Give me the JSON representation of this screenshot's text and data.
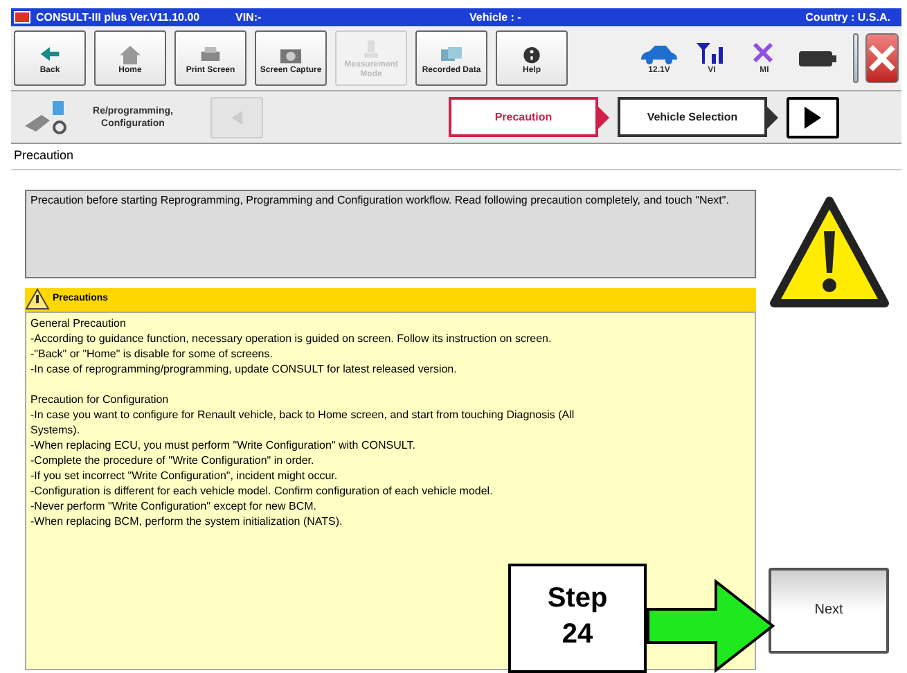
{
  "title_bar": {
    "app": "CONSULT-III plus  Ver.V11.10.00",
    "vin": "VIN:-",
    "vehicle": "Vehicle : -",
    "country": "Country : U.S.A."
  },
  "toolbar": [
    {
      "label": "Back",
      "kind": "back",
      "disabled": false
    },
    {
      "label": "Home",
      "kind": "home",
      "disabled": false
    },
    {
      "label": "Print Screen",
      "kind": "print",
      "disabled": false
    },
    {
      "label": "Screen Capture",
      "kind": "camera",
      "disabled": false
    },
    {
      "label": "Measurement Mode",
      "kind": "measure",
      "disabled": true
    },
    {
      "label": "Recorded Data",
      "kind": "data",
      "disabled": false
    },
    {
      "label": "Help",
      "kind": "help",
      "disabled": false
    }
  ],
  "indicators": [
    {
      "label": "12.1V",
      "kind": "car"
    },
    {
      "label": "VI",
      "kind": "signal"
    },
    {
      "label": "MI",
      "kind": "cross"
    },
    {
      "kind": "battery"
    }
  ],
  "breadcrumb": {
    "label": "Re/programming, Configuration"
  },
  "steps": [
    {
      "label": "Precaution",
      "selected": true
    },
    {
      "label": "Vehicle Selection",
      "selected": false
    }
  ],
  "heading": "Precaution",
  "message": "Precaution before starting Reprogramming, Programming and Configuration workflow. Read following precaution completely, and touch \"Next\".",
  "precautions": {
    "title": "Precautions",
    "sections": [
      {
        "heading": "General  Precaution",
        "lines": [
          "-According to guidance function, necessary operation is guided on screen. Follow its instruction on screen.",
          "-\"Back\" or \"Home\" is disable for some of screens.",
          "-In case of reprogramming/programming, update CONSULT for latest released version."
        ]
      },
      {
        "heading": "Precaution  for  Configuration",
        "lines": [
          "-In case you want to configure for Renault vehicle, back to Home screen, and start from touching Diagnosis  (All Systems).",
          "-When replacing ECU, you must perform \"Write Configuration\" with CONSULT.",
          "-Complete the procedure of \"Write Configuration\" in order.",
          "-If you set incorrect \"Write Configuration\", incident might occur.",
          "-Configuration is different for each vehicle model. Confirm configuration of each vehicle model.",
          "-Never perform \"Write Configuration\" except for new BCM.",
          "-When replacing BCM, perform the system initialization (NATS)."
        ]
      }
    ]
  },
  "next_button": "Next",
  "annotation": {
    "label": "Step 24"
  }
}
